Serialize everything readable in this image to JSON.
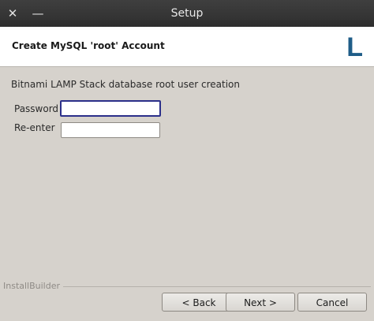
{
  "window": {
    "title": "Setup",
    "close_glyph": "✕",
    "minimize_glyph": "—"
  },
  "header": {
    "title": "Create MySQL 'root' Account",
    "logo_letter": "L"
  },
  "content": {
    "description": "Bitnami LAMP Stack database root user creation",
    "fields": [
      {
        "label": "Password",
        "value": ""
      },
      {
        "label": "Re-enter",
        "value": ""
      }
    ]
  },
  "footer": {
    "brand": "InstallBuilder",
    "back_label": "< Back",
    "next_label": "Next >",
    "cancel_label": "Cancel"
  }
}
